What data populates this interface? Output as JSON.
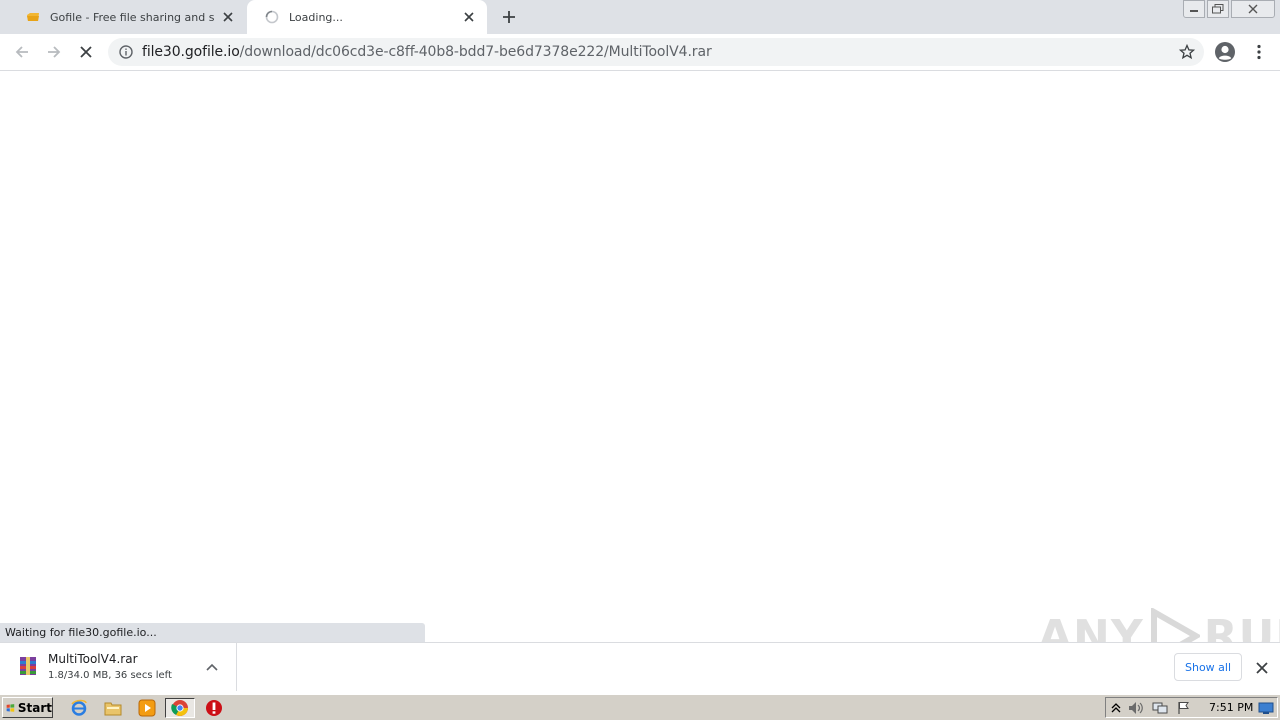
{
  "tabs": [
    {
      "title": "Gofile - Free file sharing and storage",
      "state": "inactive"
    },
    {
      "title": "Loading...",
      "state": "active"
    }
  ],
  "omnibox": {
    "host": "file30.gofile.io",
    "path": "/download/dc06cd3e-c8ff-40b8-bdd7-be6d7378e222/MultiToolV4.rar"
  },
  "status_text": "Waiting for file30.gofile.io...",
  "download": {
    "file_name": "MultiToolV4.rar",
    "progress_text": "1.8/34.0 MB, 36 secs left",
    "show_all_label": "Show all"
  },
  "watermark": {
    "left": "ANY",
    "right": "RUN"
  },
  "taskbar": {
    "start_label": "Start",
    "clock": "7:51 PM"
  },
  "colors": {
    "tabstrip": "#dee1e6",
    "accent": "#1a73e8",
    "taskbar": "#d4d0c8"
  }
}
